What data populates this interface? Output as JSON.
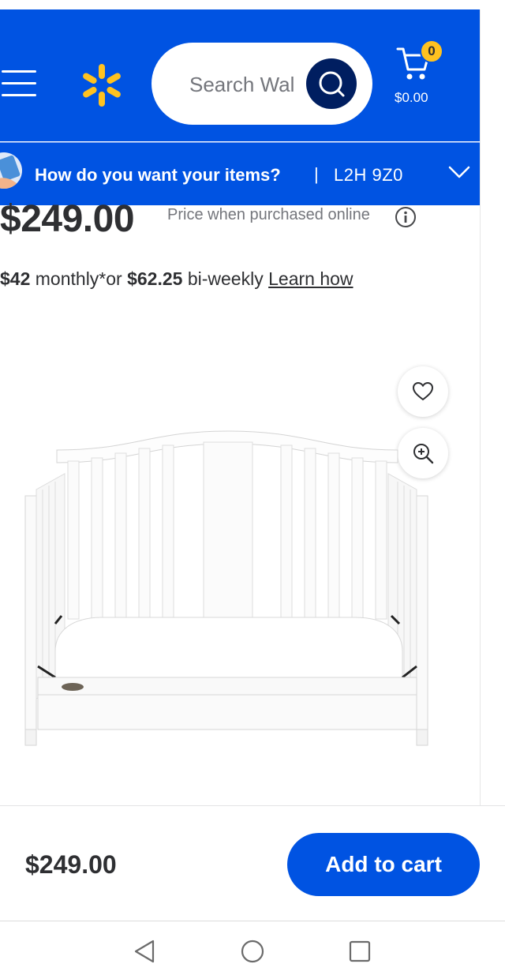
{
  "header": {
    "search_placeholder": "Search Wal",
    "cart": {
      "count": "0",
      "total": "$0.00"
    },
    "colors": {
      "brand_blue": "#0053e2",
      "spark_yellow": "#ffc220",
      "search_button": "#001e60"
    }
  },
  "fulfillment": {
    "question": "How do you want your items?",
    "separator": "|",
    "postal_code": "L2H 9Z0"
  },
  "product": {
    "price": "$249.00",
    "price_note": "Price when purchased online",
    "installments": {
      "monthly_amount": "$42",
      "monthly_text": "monthly*or",
      "biweekly_amount": "$62.25",
      "biweekly_text": "bi-weekly",
      "learn_link": "Learn how"
    },
    "image_icons": [
      "heart-icon",
      "zoom-in-icon"
    ]
  },
  "bottom_bar": {
    "price": "$249.00",
    "add_to_cart": "Add to cart"
  },
  "system_nav": [
    "back",
    "home",
    "recents"
  ]
}
